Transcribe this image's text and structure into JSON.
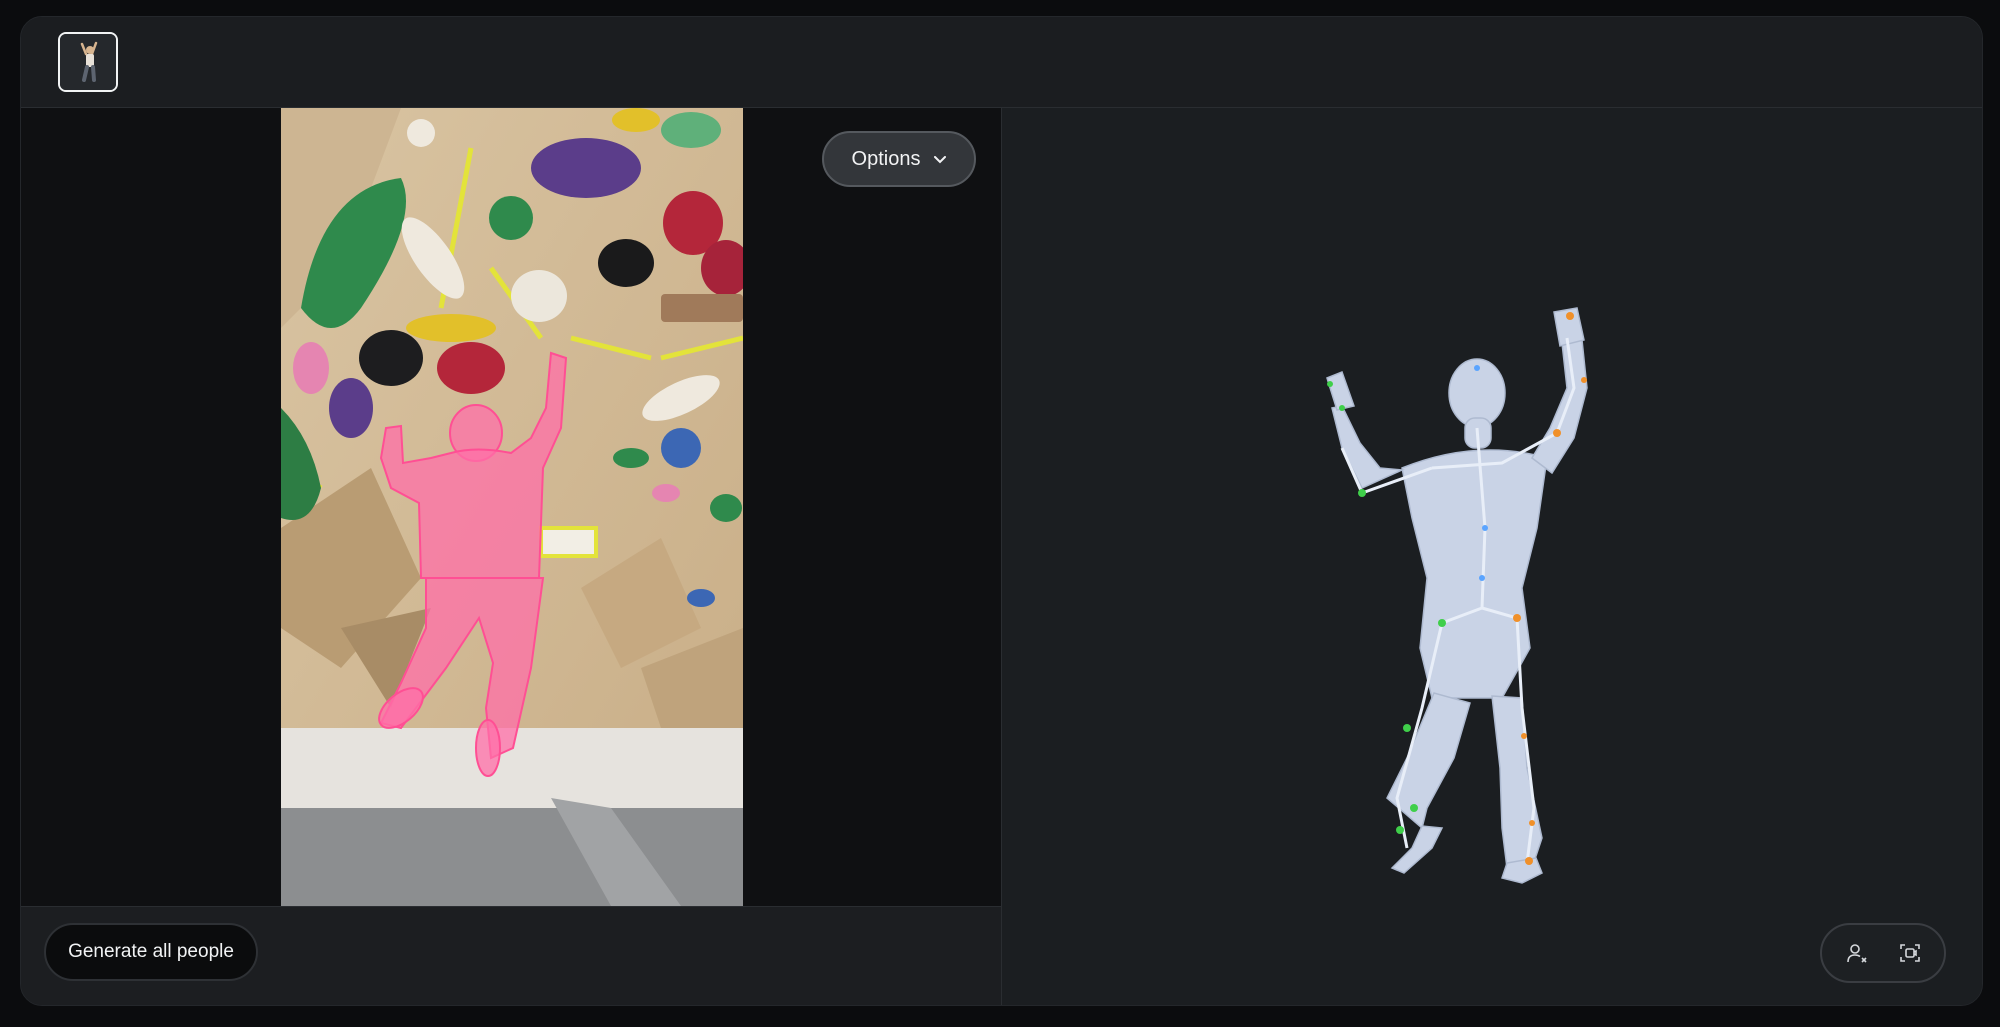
{
  "header": {
    "thumbnail_icon": "person-climbing-thumbnail"
  },
  "viewer": {
    "options_label": "Options",
    "options_icon": "chevron-down-icon"
  },
  "footer": {
    "generate_label": "Generate all people"
  },
  "model_toolbar": {
    "icons": [
      "person-remove-icon",
      "fit-to-view-icon"
    ]
  },
  "colors": {
    "segmentation_overlay": "#ff6fa8",
    "mesh": "#c9d3e6",
    "joint_left": "#3fcf4a",
    "joint_right": "#f0902a",
    "joint_spine": "#5aa4ff"
  }
}
